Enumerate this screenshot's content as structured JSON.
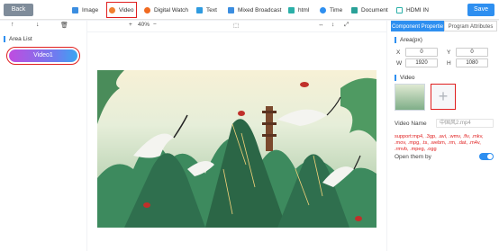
{
  "topbar": {
    "back_label": "Back",
    "save_label": "Save",
    "tools": [
      {
        "label": "Image",
        "icon": "image-icon"
      },
      {
        "label": "Video",
        "icon": "video-icon"
      },
      {
        "label": "Digital Watch",
        "icon": "clock-icon"
      },
      {
        "label": "Text",
        "icon": "text-icon"
      },
      {
        "label": "Mixed Broadcast",
        "icon": "mixed-icon"
      },
      {
        "label": "html",
        "icon": "html-icon"
      },
      {
        "label": "Time",
        "icon": "time-icon"
      },
      {
        "label": "Document",
        "icon": "document-icon"
      },
      {
        "label": "HDMI IN",
        "icon": "hdmi-icon"
      }
    ]
  },
  "left": {
    "tools": [
      "↑",
      "↓",
      "🗑"
    ],
    "area_list_title": "Area List",
    "items": [
      {
        "label": "Video1"
      }
    ]
  },
  "center": {
    "tools": [
      "+",
      "40%",
      "−",
      "⬚",
      "↔",
      "↕",
      "⤢"
    ]
  },
  "right": {
    "tabs": [
      "Component Properties",
      "Program Attributes"
    ],
    "area_title": "Area(px)",
    "x_label": "X",
    "x_value": "0",
    "y_label": "Y",
    "y_value": "0",
    "w_label": "W",
    "w_value": "1920",
    "h_label": "H",
    "h_value": "1080",
    "video_title": "Video",
    "video_name_label": "Video Name",
    "video_name_value": "中国风2.mp4",
    "support_text": "support:mp4, .3gp, .avi, .wmv, .flv, .mkv, .mov, .mpg, .ts, .webm, .rm, .dat, .m4v, .rmvb, .mpeg, .ogg",
    "open_them_label": "Open them by"
  },
  "colors": {
    "accent": "#2e8ff0",
    "highlight": "#e02020",
    "back": "#7f8c9a"
  }
}
